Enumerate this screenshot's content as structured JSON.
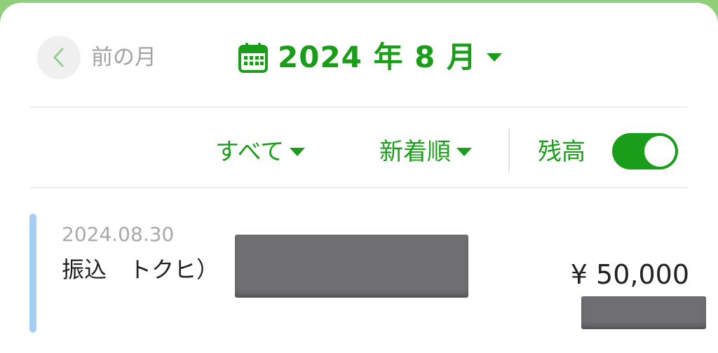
{
  "header": {
    "prev_label": "前の月",
    "month_label": "2024 年 8 月"
  },
  "filters": {
    "category": "すべて",
    "sort": "新着順",
    "balance_label": "残高",
    "balance_toggle_on": true
  },
  "transactions": [
    {
      "date": "2024.08.30",
      "description": "振込　トクヒ）",
      "amount": "¥ 50,000"
    }
  ],
  "colors": {
    "accent": "#1a9e1a",
    "row_marker": "#a6cdf2",
    "redaction": "#6f6f72"
  }
}
